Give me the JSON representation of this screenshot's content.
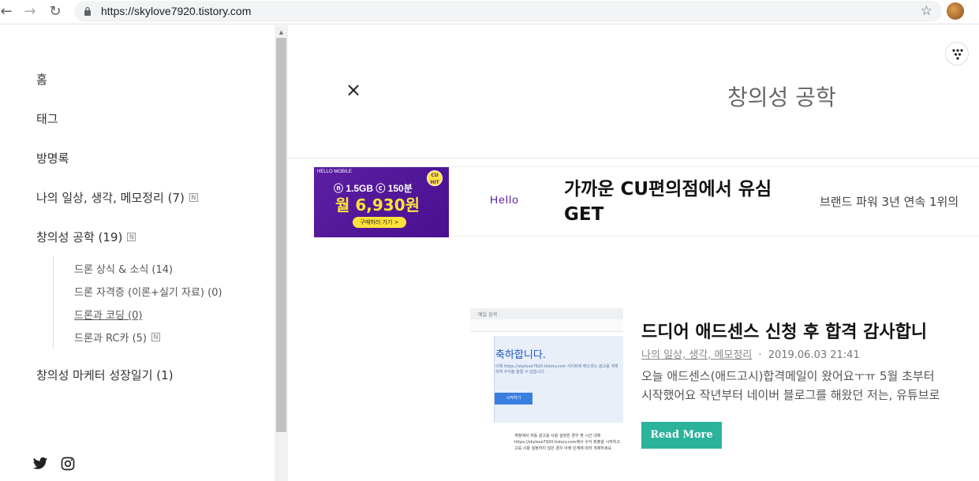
{
  "browser": {
    "url": "https://skylove7920.tistory.com",
    "back_icon": "←",
    "forward_icon": "→",
    "reload_icon": "↻",
    "star_icon": "☆"
  },
  "sidebar": {
    "items": [
      {
        "label": "홈",
        "badge": ""
      },
      {
        "label": "태그",
        "badge": ""
      },
      {
        "label": "방명록",
        "badge": ""
      },
      {
        "label": "나의 일상, 생각, 메모정리 (7)",
        "badge": "N"
      },
      {
        "label": "창의성 공학 (19)",
        "badge": "N"
      },
      {
        "label": "창의성 마케터 성장일기 (1)",
        "badge": ""
      }
    ],
    "sub_items": [
      {
        "label": "드론 상식 & 소식 (14)",
        "badge": ""
      },
      {
        "label": "드론 자격증 (이론+실기 자료) (0)",
        "badge": ""
      },
      {
        "label": "드론과 코딩 (0)",
        "badge": ""
      },
      {
        "label": "드론과 RC카 (5)",
        "badge": "N"
      }
    ]
  },
  "header": {
    "close_icon": "×",
    "title": "창의성 공학"
  },
  "ad": {
    "brand_small": "HELLO MOBILE",
    "data_line": "ⓝ 1.5GB ⓒ 150분",
    "price": "월 6,930원",
    "cta": "구매하러 가기 >",
    "cu_badge": "CU HIT",
    "logo": "Hello",
    "headline": "가까운 CU편의점에서 유심 GET",
    "description": "브랜드 파워 3년 연속 1위의"
  },
  "post": {
    "thumb": {
      "topbar": "메일 검색",
      "card_title": "축하합니다.",
      "card_text": "이제 https://skylove7920.tistory.com 사이트에 애드센스 광고를 게재하여 수익을 올릴 수 있습니다.",
      "card_button": "시작하기",
      "foot_text": "계정에서 자동 광고를 사용 설정한 경우 몇 시간 내에 https://skylove7920.tistory.com에서 수익 창출을 시작하고 고를 사용 설정하지 않은 경우 아래 단계에 따라 게재하세요."
    },
    "title": "드디어 애드센스 신청 후 합격 감사합니",
    "category": "나의 일상, 생각, 메모정리",
    "meta_sep": "·",
    "date": "2019.06.03 21:41",
    "excerpt_line1": "오늘 애드센스(애드고시)합격메일이 왔어요ㅜㅠ 5월 초부터",
    "excerpt_line2": "시작했어요 작년부터 네이버 블로그를 해왔던 저는, 유튜브로",
    "read_more": "Read More"
  },
  "social": {
    "twitter_icon": "twitter-icon",
    "instagram_icon": "instagram-icon"
  }
}
